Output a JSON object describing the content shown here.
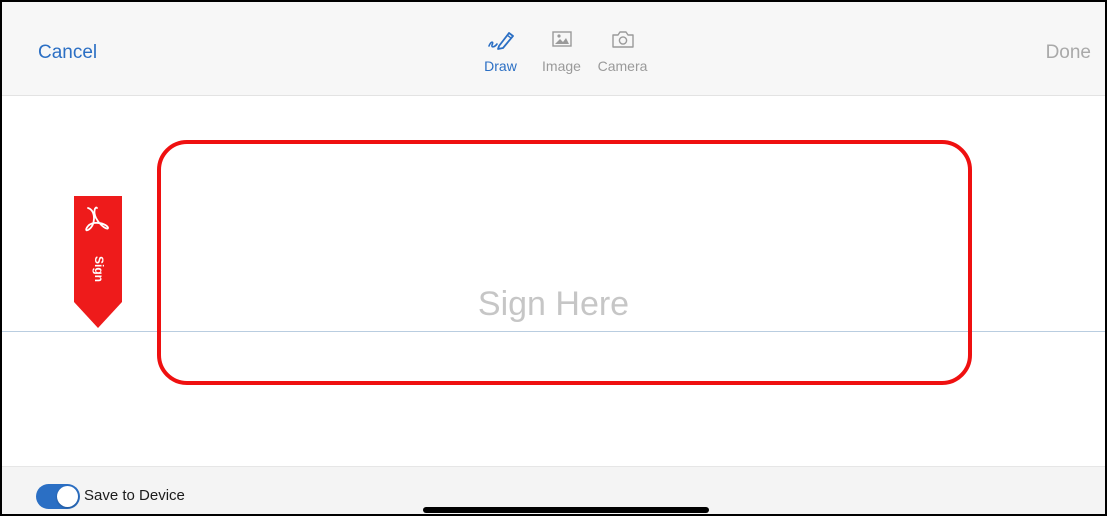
{
  "toolbar": {
    "cancel_label": "Cancel",
    "done_label": "Done",
    "tabs": [
      {
        "label": "Draw",
        "icon": "pen-icon",
        "active": true
      },
      {
        "label": "Image",
        "icon": "image-icon",
        "active": false
      },
      {
        "label": "Camera",
        "icon": "camera-icon",
        "active": false
      }
    ]
  },
  "signature": {
    "placeholder": "Sign Here",
    "flag_label": "Sign",
    "flag_icon": "adobe-acrobat-icon"
  },
  "bottom_bar": {
    "save_toggle_label": "Save to Device",
    "save_toggle_on": true
  },
  "colors": {
    "accent": "#2b6fc4",
    "highlight": "#ef1010",
    "flag": "#ee1b1b",
    "disabled": "#a9a9a9"
  }
}
